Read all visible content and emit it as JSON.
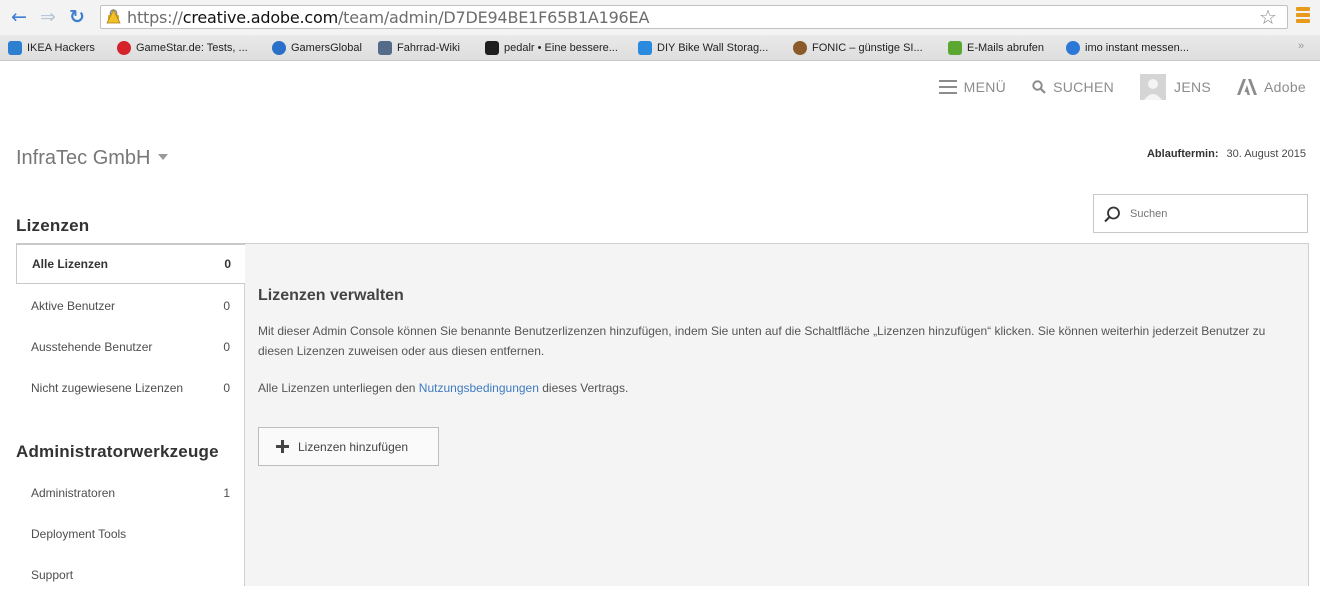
{
  "browser": {
    "url_secure_prefix": "https://",
    "url_host": "creative.adobe.com",
    "url_path": "/team/admin/D7DE94BE1F65B1A196EA",
    "bookmarks": [
      {
        "label": "IKEA Hackers",
        "color": "#2f7fd0"
      },
      {
        "label": "GameStar.de: Tests, ...",
        "color": "#d4232b"
      },
      {
        "label": "GamersGlobal",
        "color": "#2a70c8"
      },
      {
        "label": "Fahrrad-Wiki",
        "color": "#556b8a"
      },
      {
        "label": "pedalr • Eine bessere...",
        "color": "#1e1e1e"
      },
      {
        "label": "DIY Bike Wall Storag...",
        "color": "#2a8ae0"
      },
      {
        "label": "FONIC – günstige SI...",
        "color": "#8a5a2b"
      },
      {
        "label": "E-Mails abrufen",
        "color": "#5aa832"
      },
      {
        "label": "imo instant messen...",
        "color": "#2b78d6"
      }
    ],
    "bookmarks_more": "»"
  },
  "header": {
    "menu_label": "MENÜ",
    "search_label": "SUCHEN",
    "user_label": "JENS",
    "brand_label": "Adobe"
  },
  "org": {
    "name": "InfraTec GmbH",
    "expiry_label": "Ablauftermin:",
    "expiry_value": "30. August 2015"
  },
  "search": {
    "placeholder": "Suchen"
  },
  "sidebar": {
    "licenses_title": "Lizenzen",
    "licenses_items": [
      {
        "label": "Alle Lizenzen",
        "count": "0"
      },
      {
        "label": "Aktive Benutzer",
        "count": "0"
      },
      {
        "label": "Ausstehende Benutzer",
        "count": "0"
      },
      {
        "label": "Nicht zugewiesene Lizenzen",
        "count": "0"
      }
    ],
    "admin_title": "Administratorwerkzeuge",
    "admin_items": [
      {
        "label": "Administratoren",
        "count": "1"
      },
      {
        "label": "Deployment Tools",
        "count": ""
      },
      {
        "label": "Support",
        "count": ""
      }
    ]
  },
  "main": {
    "title": "Lizenzen verwalten",
    "description": "Mit dieser Admin Console können Sie benannte Benutzerlizenzen hinzufügen, indem Sie unten auf die Schaltfläche „Lizenzen hinzufügen“ klicken. Sie können weiterhin jederzeit Benutzer zu diesen Lizenzen zuweisen oder aus diesen entfernen.",
    "terms_prefix": "Alle Lizenzen unterliegen den",
    "terms_link": "Nutzungsbedingungen",
    "terms_suffix": "dieses Vertrags.",
    "add_button_label": "Lizenzen hinzufügen"
  },
  "colors": {
    "link": "#3e7bc1",
    "panel_bg": "#f4f4f4",
    "browser_accent": "#3e7fd1"
  }
}
